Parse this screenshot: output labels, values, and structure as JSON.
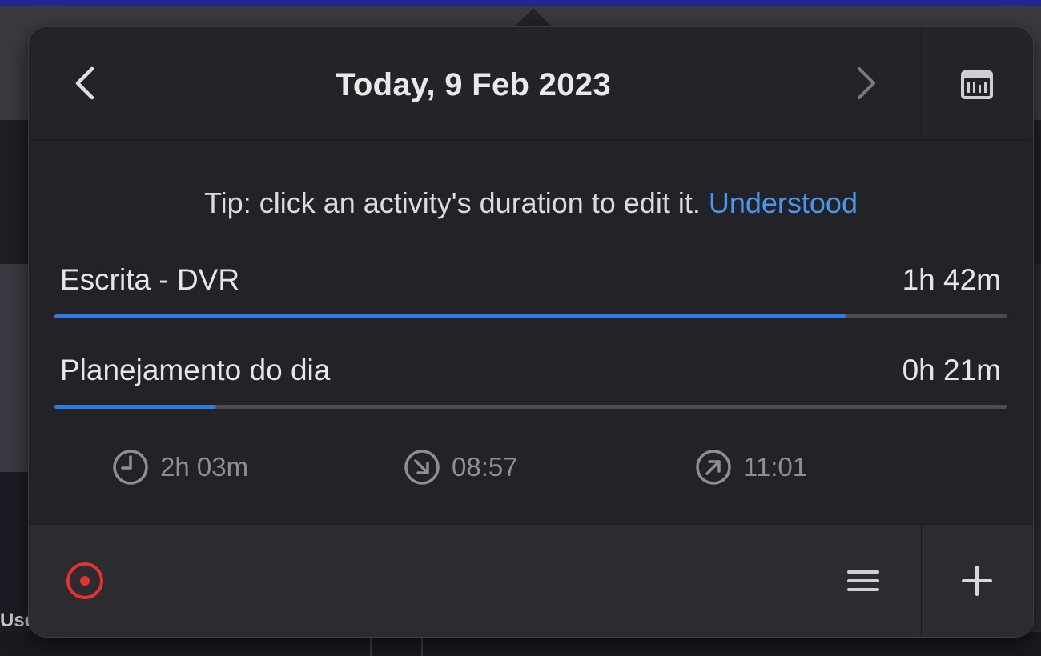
{
  "header": {
    "date_title": "Today, 9 Feb 2023"
  },
  "tip": {
    "text": "Tip: click an activity's duration to edit it.",
    "link": "Understood"
  },
  "activities": [
    {
      "name": "Escrita - DVR",
      "duration": "1h 42m",
      "progress": 0.83
    },
    {
      "name": "Planejamento do dia",
      "duration": "0h 21m",
      "progress": 0.17
    }
  ],
  "stats": {
    "total": "2h 03m",
    "start": "08:57",
    "end": "11:01"
  },
  "icons": {
    "prev": "chevron-left-icon",
    "next": "chevron-right-icon",
    "calendar": "calendar-icon",
    "total": "clock-icon",
    "start": "arrow-in-icon",
    "end": "arrow-out-icon",
    "record": "record-icon",
    "menu": "list-icon",
    "add": "plus-icon"
  },
  "colors": {
    "accent": "#2f7be6",
    "link": "#4a97f2",
    "record": "#e5322b",
    "background": "#232328"
  },
  "background": {
    "left_fragment_text": "Use"
  }
}
